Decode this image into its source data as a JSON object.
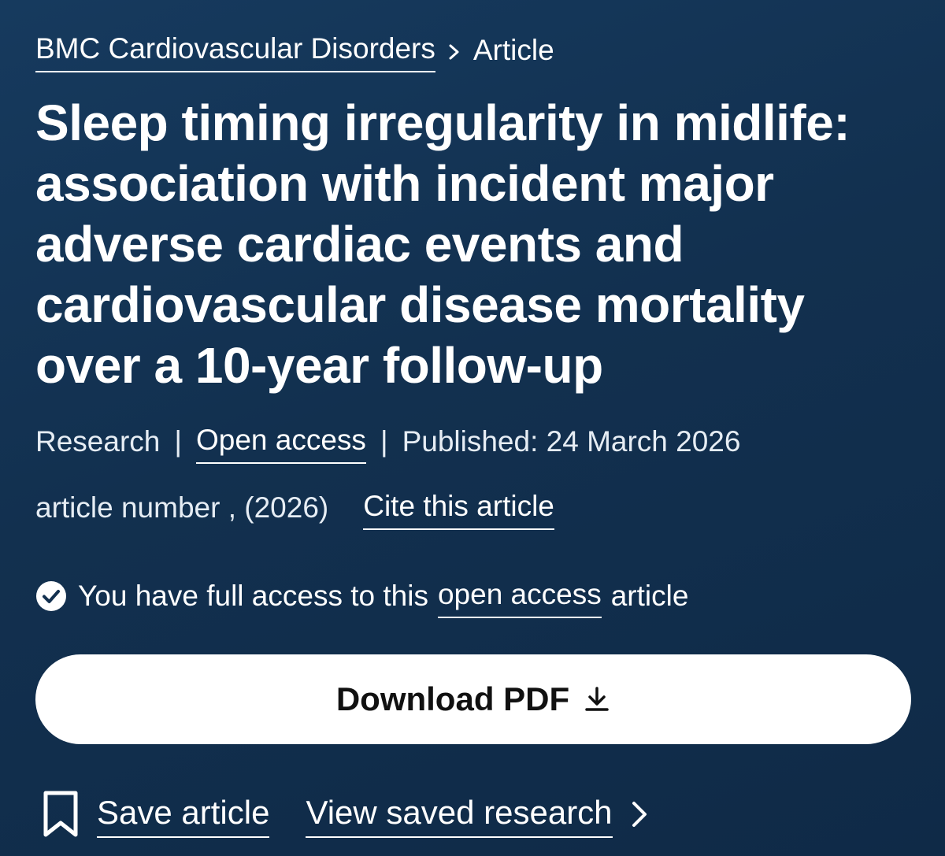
{
  "breadcrumb": {
    "journal": "BMC Cardiovascular Disorders",
    "current": "Article"
  },
  "article": {
    "title": "Sleep timing irregularity in midlife: association with incident major adverse cardiac events and cardiovascular disease mortality over a 10-year follow-up",
    "type": "Research",
    "access": "Open access",
    "published": "Published: 24 March 2026",
    "citation": "article number , (2026)",
    "cite_link": "Cite this article"
  },
  "access_notice": {
    "prefix": "You have full access to this",
    "link": "open access",
    "suffix": "article"
  },
  "download": {
    "label": "Download PDF"
  },
  "actions": {
    "save": "Save article",
    "view_saved": "View saved research"
  },
  "icons": {
    "breadcrumb_separator": "chevron-right-icon",
    "access": "check-circle-icon",
    "download": "download-icon",
    "save": "bookmark-icon",
    "view_saved": "chevron-right-icon"
  },
  "colors": {
    "background": "#12304f",
    "text": "#ffffff",
    "button_bg": "#ffffff",
    "button_text": "#111111"
  }
}
